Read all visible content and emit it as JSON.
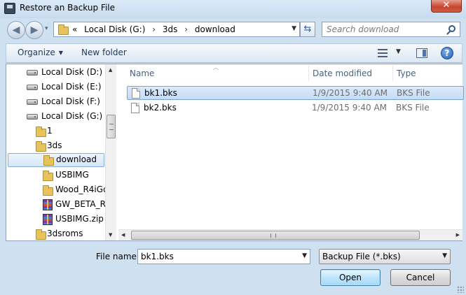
{
  "window": {
    "title": "Restore an Backup File",
    "close_glyph": "✕"
  },
  "nav": {
    "back_glyph": "◀",
    "forward_glyph": "▶",
    "recent_glyph": "▾",
    "crumb_overflow": "«",
    "breadcrumb": [
      "Local Disk (G:)",
      "3ds",
      "download"
    ],
    "crumb_separator": "›",
    "refresh_glyph": "⇆",
    "search_placeholder": "Search download"
  },
  "toolbar": {
    "organize_label": "Organize",
    "new_folder_label": "New folder",
    "caret_glyph": "▼",
    "help_glyph": "?"
  },
  "tree": {
    "drives": [
      {
        "label": "Local Disk (D:)"
      },
      {
        "label": "Local Disk (E:)"
      },
      {
        "label": "Local Disk (F:)"
      },
      {
        "label": "Local Disk (G:)"
      }
    ],
    "folder_1": "1",
    "folder_3ds": "3ds",
    "folder_download": "download",
    "folder_usbimg": "USBIMG",
    "folder_wood": "Wood_R4iGo",
    "zip_gw": "GW_BETA_RE",
    "zip_usbimg": "USBIMG.zip",
    "folder_3dsroms": "3dsroms"
  },
  "columns": {
    "name": "Name",
    "date": "Date modified",
    "type": "Type"
  },
  "files": [
    {
      "name": "bk1.bks",
      "date": "1/9/2015 9:40 AM",
      "type": "BKS File"
    },
    {
      "name": "bk2.bks",
      "date": "1/9/2015 9:40 AM",
      "type": "BKS File"
    }
  ],
  "bottom": {
    "file_name_label": "File name:",
    "file_name_value": "bk1.bks",
    "file_type_value": "Backup File (*.bks)",
    "open_label": "Open",
    "cancel_label": "Cancel"
  }
}
